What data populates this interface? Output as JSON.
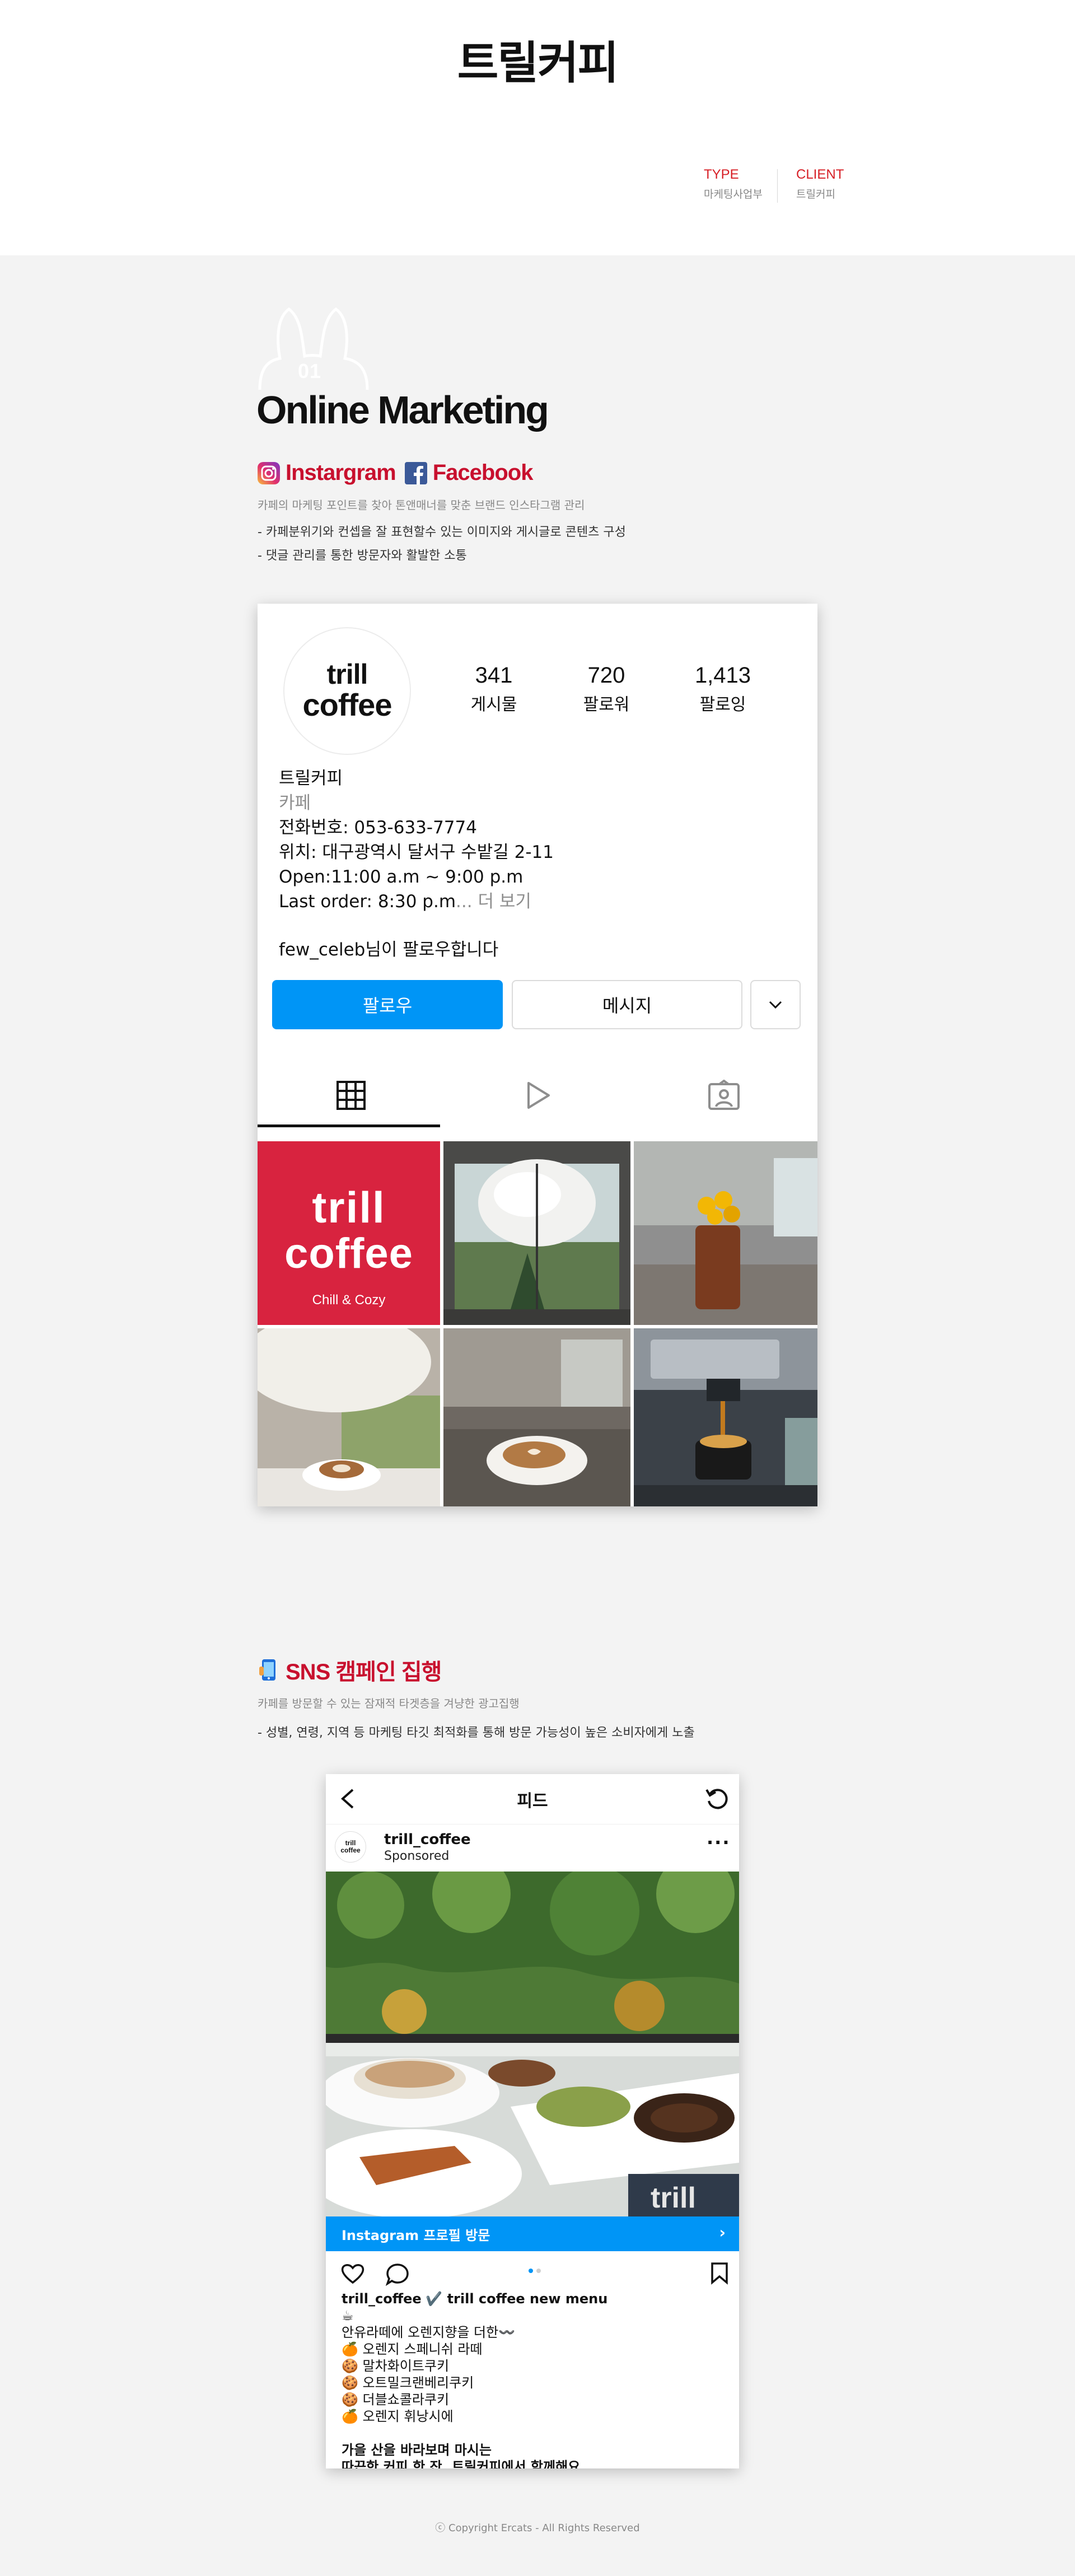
{
  "header": {
    "title": "트릴커피",
    "type_label": "TYPE",
    "type_value": "마케팅사업부",
    "client_label": "CLIENT",
    "client_value": "트릴커피"
  },
  "section1": {
    "number": "01",
    "title": "Online Marketing",
    "heading_a": "Instargram",
    "heading_b": "Facebook",
    "description": "카페의 마케팅 포인트를 찾아 톤앤매너를 맞춘 브랜드 인스타그램 관리",
    "bullets": [
      "- 카페분위기와 컨셉을 잘 표현할수 있는 이미지와 게시글로 콘텐츠 구성",
      "- 댓글 관리를 통한 방문자와 활발한 소통"
    ]
  },
  "profile": {
    "logo_line1": "trill",
    "logo_line2": "coffee",
    "stats": [
      {
        "num": "341",
        "label": "게시물"
      },
      {
        "num": "720",
        "label": "팔로워"
      },
      {
        "num": "1,413",
        "label": "팔로잉"
      }
    ],
    "name": "트릴커피",
    "category": "카페",
    "phone": "전화번호: 053-633-7774",
    "location": "위치: 대구광역시 달서구 수밭길 2-11",
    "open": "Open:11:00 a.m ~ 9:00 p.m",
    "last_order": "Last order: 8:30 p.m",
    "more": "... 더 보기",
    "follow_note": "few_celeb님이 팔로우합니다",
    "follow_btn": "팔로우",
    "message_btn": "메시지",
    "grid_logo1": "trill",
    "grid_logo2": "coffee",
    "grid_tagline": "Chill & Cozy"
  },
  "section2": {
    "title": "SNS 캠페인 집행",
    "description": "카페를 방문할 수 있는 잠재적 타겟층을 겨냥한 광고집행",
    "bullet": "- 성별, 연령, 지역 등 마케팅 타깃 최적화를 통해 방문 가능성이 높은 소비자에게 노출"
  },
  "feed": {
    "title": "피드",
    "user": "trill_coffee",
    "sponsored": "Sponsored",
    "avatar_l1": "trill",
    "avatar_l2": "coffee",
    "cta": "Instagram 프로필 방문",
    "caption_user": "trill_coffee",
    "caption_head": "✔️ trill coffee new menu",
    "caption_lines": [
      "☕",
      "안유라떼에 오렌지향을 더한〰️",
      "🍊 오렌지 스페니쉬 라떼",
      "🍪 말차화이트쿠키",
      "🍪 오트밀크랜베리쿠키",
      "🍪 더블쇼콜라쿠키",
      "🍊 오렌지 휘낭시에",
      "",
      "가을 산을 바라보며 마시는",
      "따끈한 커피 한 잔, 트릴커피에서 함께해요."
    ],
    "photo_sign": "trill"
  },
  "footer": {
    "copyright": "ⓒ Copyright  Ercats - All Rights Reserved"
  }
}
